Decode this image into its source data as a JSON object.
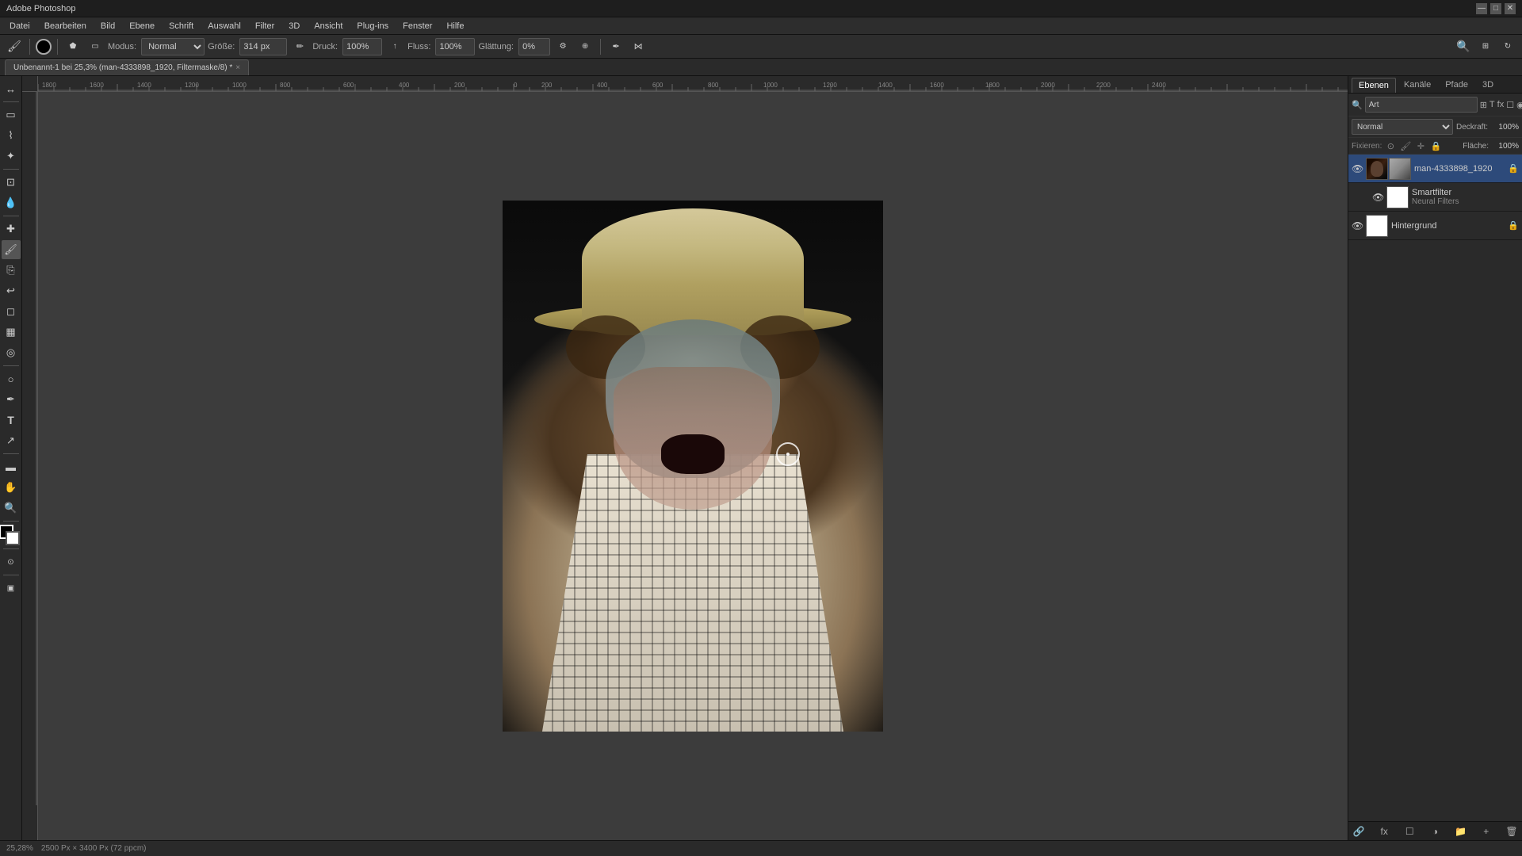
{
  "titlebar": {
    "title": "Adobe Photoshop",
    "controls": [
      "—",
      "□",
      "✕"
    ]
  },
  "menubar": {
    "items": [
      "Datei",
      "Bearbeiten",
      "Bild",
      "Ebene",
      "Schrift",
      "Auswahl",
      "Filter",
      "3D",
      "Ansicht",
      "Plug-ins",
      "Fenster",
      "Hilfe"
    ]
  },
  "toolbar": {
    "mode_label": "Modus:",
    "mode_value": "Normal",
    "size_label": "Größe:",
    "size_value": "314 px",
    "opacity_label": "Druck:",
    "opacity_value": "100%",
    "flow_label": "Fluss:",
    "flow_value": "100%",
    "smooth_label": "Glättung:",
    "smooth_value": "0%"
  },
  "tab": {
    "name": "Unbenannt-1 bei 25,3% (man-4333898_1920, Filtermaske/8) *",
    "close": "×"
  },
  "canvas": {
    "zoom": "25,28%",
    "info": "2500 Px × 3400 Px (72 ppcm)"
  },
  "right_panel": {
    "tabs": [
      "Ebenen",
      "Kanäle",
      "Pfade",
      "3D"
    ],
    "active_tab": "Ebenen",
    "search_placeholder": "Art",
    "blend_mode": "Normal",
    "opacity_label": "Deckraft:",
    "opacity_value": "100%",
    "fill_label": "Fläche:",
    "fill_value": "100%",
    "lock_label": "Fixieren:",
    "layers": [
      {
        "id": "man-layer",
        "name": "man-4333898_1920",
        "visible": true,
        "has_mask": true,
        "locked": true,
        "type": "smart-object",
        "children": [
          {
            "id": "smartfilter",
            "name": "Smartfilter",
            "visible": true,
            "type": "smartfilter",
            "sub_items": [
              "Neural Filters"
            ]
          }
        ]
      },
      {
        "id": "hintergrund",
        "name": "Hintergrund",
        "visible": true,
        "type": "background",
        "locked": true
      }
    ]
  },
  "status_bar": {
    "zoom": "25,28%",
    "dimensions": "2500 Px × 3400 Px (72 ppcm)"
  }
}
